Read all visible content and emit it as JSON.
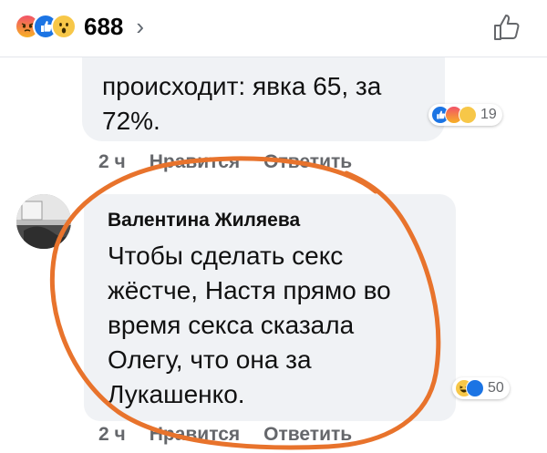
{
  "header": {
    "reaction_icons": [
      "angry-icon",
      "like-icon",
      "wow-icon"
    ],
    "reaction_count": "688",
    "chevron": "›"
  },
  "comment_prev": {
    "text_line1": "происходит: явка 65, за",
    "text_line2": "72%.",
    "reaction_icons": [
      "like-icon",
      "angry-icon",
      "sad-icon"
    ],
    "reaction_count": "19",
    "time": "2 ч",
    "like_label": "Нравится",
    "reply_label": "Ответить"
  },
  "comment_main": {
    "author": "Валентина Жиляева",
    "lines": [
      "Чтобы сделать секс",
      "жёстче, Настя прямо во",
      "время секса сказала",
      "Олегу, что она за",
      "Лукашенко."
    ],
    "reaction_icons": [
      "haha-icon",
      "like-icon"
    ],
    "reaction_count": "50",
    "time": "2 ч",
    "like_label": "Нравится",
    "reply_label": "Ответить"
  },
  "colors": {
    "accent_like": "#1b74e4",
    "bubble_bg": "#f0f2f5",
    "annotation": "#e8732c"
  }
}
